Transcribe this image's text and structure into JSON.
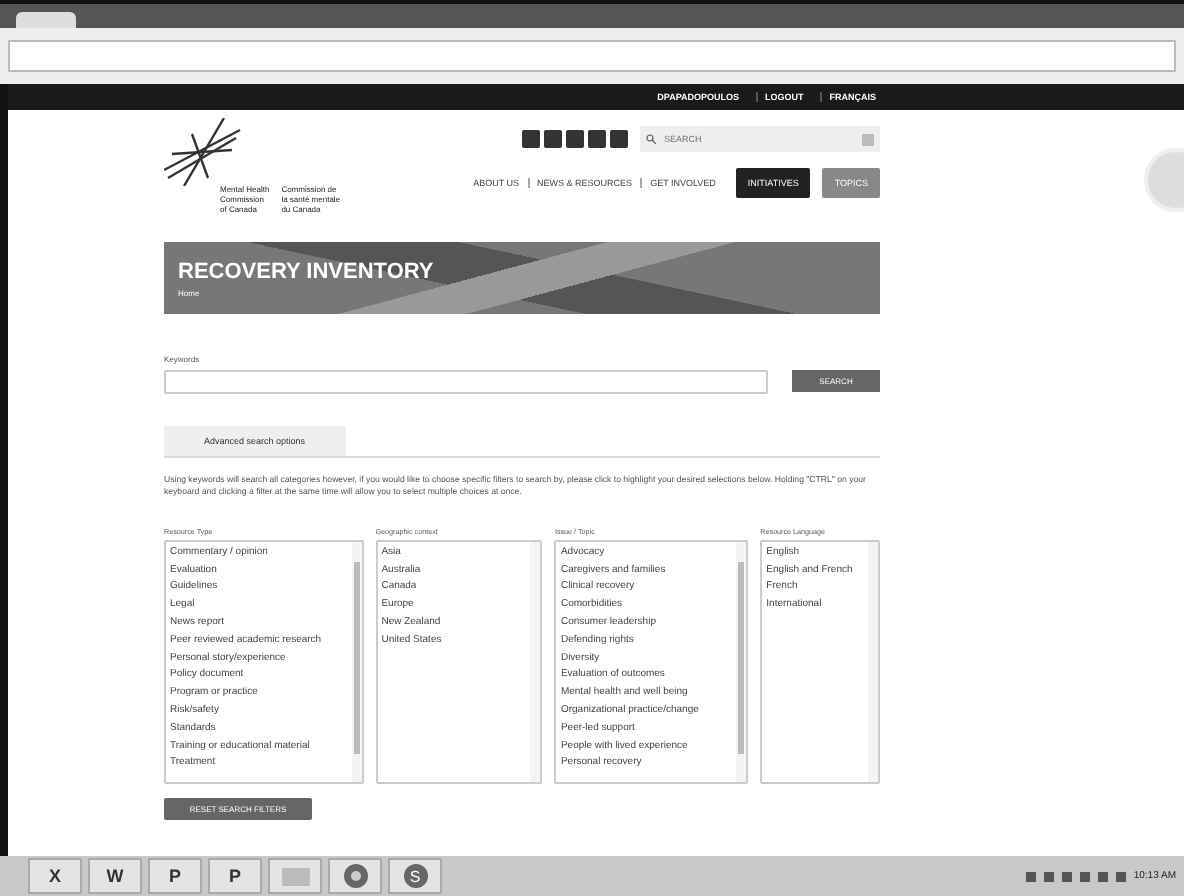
{
  "header_links": [
    "DPAPADOPOULOS",
    "LOGOUT",
    "FRANÇAIS"
  ],
  "logo": {
    "english": "Mental Health\nCommission\nof Canada",
    "french": "Commission de\nla santé mentale\ndu Canada"
  },
  "site_search": {
    "placeholder": "SEARCH"
  },
  "nav": [
    {
      "label": "ABOUT US",
      "kind": "link"
    },
    {
      "label": "NEWS & RESOURCES",
      "kind": "link"
    },
    {
      "label": "GET INVOLVED",
      "kind": "link"
    },
    {
      "label": "INITIATIVES",
      "kind": "dark"
    },
    {
      "label": "TOPICS",
      "kind": "light"
    }
  ],
  "banner": {
    "title": "RECOVERY INVENTORY",
    "breadcrumb": "Home"
  },
  "keywords": {
    "label": "Keywords",
    "button": "SEARCH"
  },
  "tabs": [
    {
      "label": "Advanced search options",
      "selected": true
    }
  ],
  "help_text": "Using keywords will search all categories however, if you would like to choose specific filters to search by, please click to highlight your desired selections below. Holding \"CTRL\" on your keyboard and clicking a filter at the same time will allow you to select multiple choices at once.",
  "filters": [
    {
      "label": "Resource Type",
      "scrolls": true,
      "items": [
        "Commentary / opinion",
        "Evaluation",
        "Guidelines",
        "Legal",
        "News report",
        "Peer reviewed academic research",
        "Personal story/experience",
        "Policy document",
        "Program or practice",
        "Risk/safety",
        "Standards",
        "Training or educational material",
        "Treatment"
      ]
    },
    {
      "label": "Geographic context",
      "scrolls": false,
      "items": [
        "Asia",
        "Australia",
        "Canada",
        "Europe",
        "New Zealand",
        "United States"
      ]
    },
    {
      "label": "Issue / Topic",
      "scrolls": true,
      "items": [
        "Advocacy",
        "Caregivers and families",
        "Clinical recovery",
        "Comorbidities",
        "Consumer leadership",
        "Defending rights",
        "Diversity",
        "Evaluation of outcomes",
        "Mental health and well being",
        "Organizational practice/change",
        "Peer-led support",
        "People with lived experience",
        "Personal recovery"
      ]
    },
    {
      "label": "Resource Language",
      "scrolls": false,
      "items": [
        "English",
        "English and French",
        "French",
        "International"
      ]
    }
  ],
  "reset_button": "RESET SEARCH FILTERS",
  "taskbar": {
    "apps": [
      {
        "letter": "X",
        "kind": "office"
      },
      {
        "letter": "W",
        "kind": "office"
      },
      {
        "letter": "P",
        "kind": "office"
      },
      {
        "letter": "P",
        "kind": "office"
      },
      {
        "kind": "folder"
      },
      {
        "kind": "browser"
      },
      {
        "letter": "S",
        "kind": "round"
      }
    ],
    "clock": "10:13 AM"
  }
}
